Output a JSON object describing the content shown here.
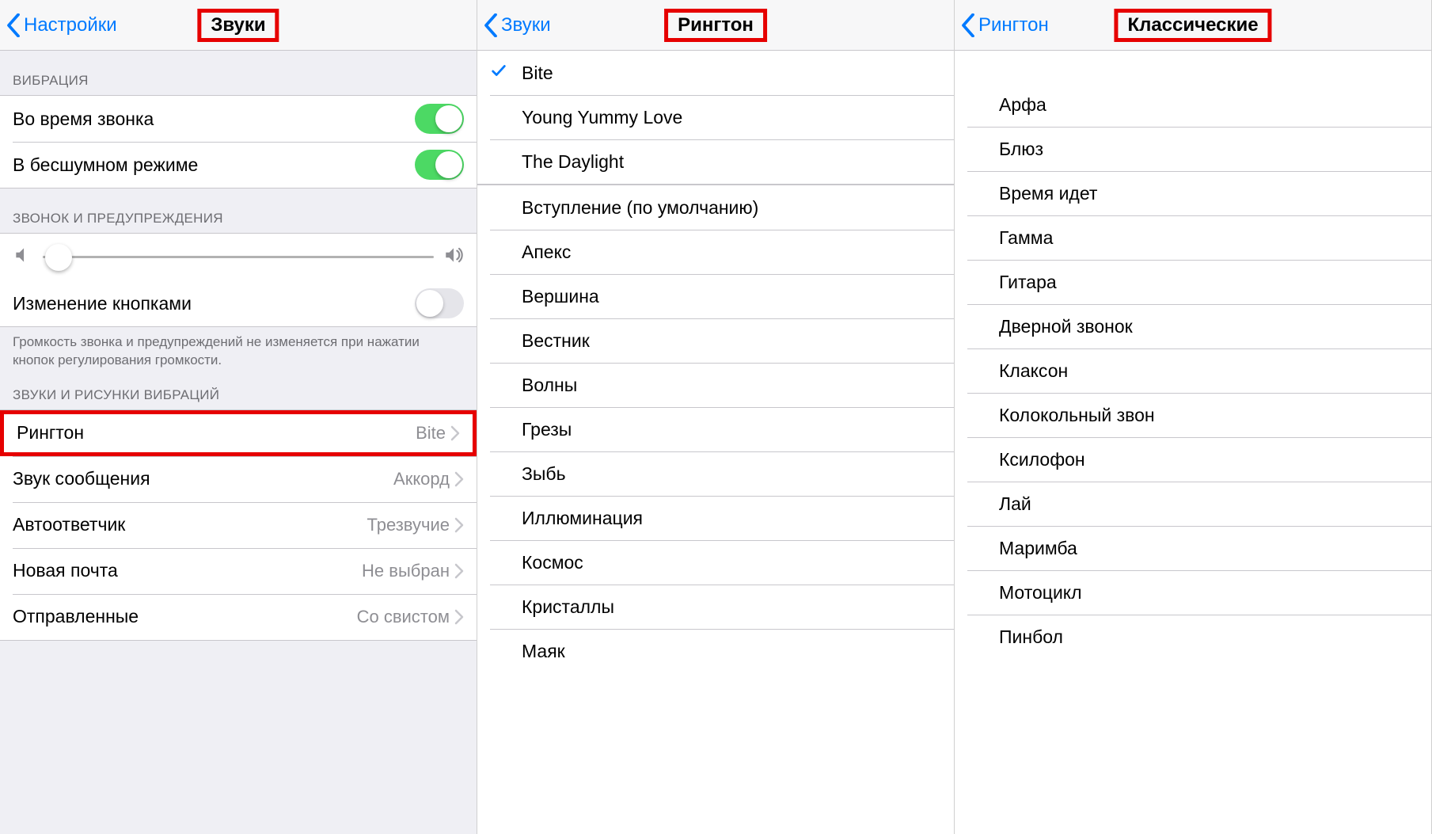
{
  "screen1": {
    "back": "Настройки",
    "title": "Звуки",
    "vibration_header": "ВИБРАЦИЯ",
    "vibrate_on_ring": "Во время звонка",
    "vibrate_on_silent": "В бесшумном режиме",
    "ringer_header": "ЗВОНОК И ПРЕДУПРЕЖДЕНИЯ",
    "change_with_buttons": "Изменение кнопками",
    "change_footer": "Громкость звонка и предупреждений не изменяется при нажатии кнопок регулирования громкости.",
    "sounds_header": "ЗВУКИ И РИСУНКИ ВИБРАЦИЙ",
    "rows": [
      {
        "label": "Рингтон",
        "value": "Bite"
      },
      {
        "label": "Звук сообщения",
        "value": "Аккорд"
      },
      {
        "label": "Автоответчик",
        "value": "Трезвучие"
      },
      {
        "label": "Новая почта",
        "value": "Не выбран"
      },
      {
        "label": "Отправленные",
        "value": "Со свистом"
      }
    ]
  },
  "screen2": {
    "back": "Звуки",
    "title": "Рингтон",
    "selected_index": 0,
    "top_items": [
      "Bite",
      "Young Yummy Love",
      "The Daylight"
    ],
    "items": [
      "Вступление (по умолчанию)",
      "Апекс",
      "Вершина",
      "Вестник",
      "Волны",
      "Грезы",
      "Зыбь",
      "Иллюминация",
      "Космос",
      "Кристаллы",
      "Маяк"
    ]
  },
  "screen3": {
    "back": "Рингтон",
    "title": "Классические",
    "items": [
      "Арфа",
      "Блюз",
      "Время идет",
      "Гамма",
      "Гитара",
      "Дверной звонок",
      "Клаксон",
      "Колокольный звон",
      "Ксилофон",
      "Лай",
      "Маримба",
      "Мотоцикл",
      "Пинбол"
    ]
  }
}
